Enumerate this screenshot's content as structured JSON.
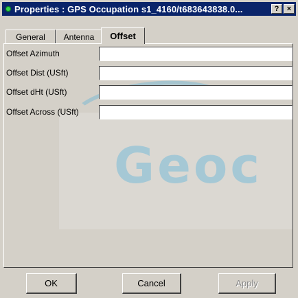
{
  "window": {
    "title": "Properties : GPS Occupation s1_4160/t683643838.0...",
    "help_button": "?",
    "close_button": "×"
  },
  "tabs": [
    {
      "label": "General",
      "active": false
    },
    {
      "label": "Antenna",
      "active": false
    },
    {
      "label": "Offset",
      "active": true
    }
  ],
  "fields": [
    {
      "label": "Offset Azimuth",
      "value": ""
    },
    {
      "label": "Offset Dist (USft)",
      "value": ""
    },
    {
      "label": "Offset dHt (USft)",
      "value": ""
    },
    {
      "label": "Offset Across (USft)",
      "value": ""
    }
  ],
  "watermark": "Geoc",
  "buttons": {
    "ok": "OK",
    "cancel": "Cancel",
    "apply": "Apply"
  },
  "colors": {
    "titlebar": "#0a246a",
    "face": "#d4d0c8",
    "status_dot": "#2fd24a"
  }
}
